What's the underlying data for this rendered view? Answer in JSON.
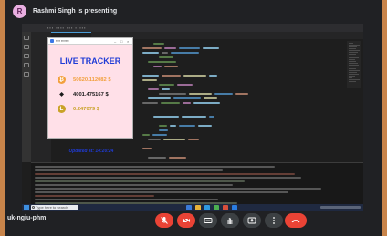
{
  "meet": {
    "presenter_initial": "R",
    "presenter_text": "Rashmi Singh is presenting",
    "meeting_code": "uk-ngiu-phm"
  },
  "taskbar": {
    "search_placeholder": "Type here to search"
  },
  "tracker": {
    "heading": "LIVE TRACKER",
    "coins": [
      {
        "symbol": "₿",
        "value": "50620.112082 $",
        "color": "#f2a03d"
      },
      {
        "symbol": "◆",
        "value": "4001.475167 $",
        "color": "#1a1a1a"
      },
      {
        "symbol": "Ł",
        "value": "0.247079 $",
        "color": "#c9a227"
      }
    ],
    "updated": "Updated at: 14:20:24"
  },
  "controls": [
    {
      "icon": "mic-off-icon",
      "color": "#ea4335"
    },
    {
      "icon": "camera-off-icon",
      "color": "#ea4335"
    },
    {
      "icon": "captions-icon",
      "color": "#3c4043"
    },
    {
      "icon": "raise-hand-icon",
      "color": "#3c4043"
    },
    {
      "icon": "present-screen-icon",
      "color": "#3c4043"
    },
    {
      "icon": "more-options-icon",
      "color": "#3c4043"
    },
    {
      "icon": "end-call-icon",
      "color": "#ea4335"
    }
  ],
  "colors": {
    "meet_background": "#202124",
    "tracker_background": "#ffe0e8",
    "tracker_accent": "#1f3bd6",
    "end_call": "#ea4335"
  }
}
